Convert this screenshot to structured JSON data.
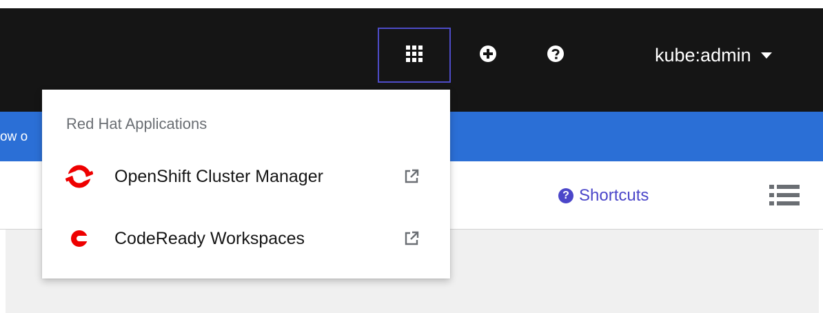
{
  "masthead": {
    "app_launcher_icon": "grid-icon",
    "add_icon": "plus-circle-icon",
    "help_icon": "question-circle-icon",
    "user_name": "kube:admin",
    "user_caret_icon": "caret-down-icon",
    "background_color": "#151515",
    "launcher_focus_color": "#4e4cc9"
  },
  "banner": {
    "text_fragment": "ow o",
    "background_color": "#2b6fd6"
  },
  "toolbar": {
    "shortcuts_icon": "question-circle-icon",
    "shortcuts_label": "Shortcuts",
    "list_view_icon": "list-icon",
    "accent_color": "#4b46c9"
  },
  "app_launcher_menu": {
    "group_title": "Red Hat Applications",
    "items": [
      {
        "label": "OpenShift Cluster Manager",
        "icon": "openshift-cluster-manager-logo",
        "external_icon": "external-link-icon"
      },
      {
        "label": "CodeReady Workspaces",
        "icon": "codeready-workspaces-logo",
        "external_icon": "external-link-icon"
      }
    ]
  }
}
